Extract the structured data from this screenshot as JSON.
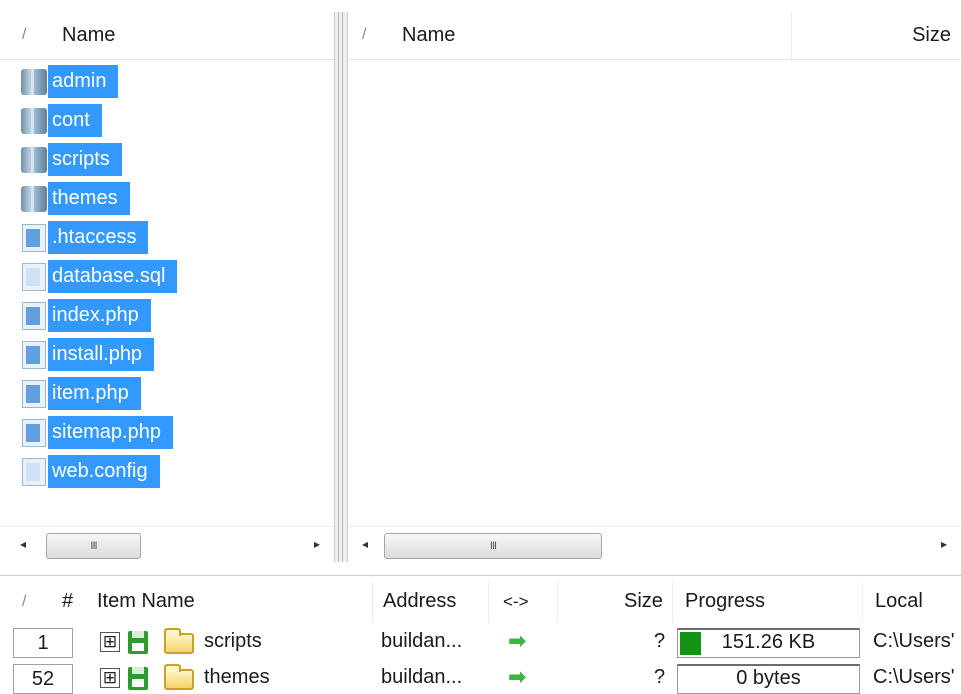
{
  "left_pane": {
    "sort_glyph": "/",
    "header_name": "Name",
    "scroll_thumb_grip": "III",
    "scroll_left": "◂",
    "scroll_right": "▸",
    "files": [
      {
        "name": "admin",
        "icon": "folder-icon"
      },
      {
        "name": "cont",
        "icon": "folder-icon"
      },
      {
        "name": "scripts",
        "icon": "folder-icon"
      },
      {
        "name": "themes",
        "icon": "folder-icon"
      },
      {
        "name": ".htaccess",
        "icon": "file-icon"
      },
      {
        "name": "database.sql",
        "icon": "file-icon"
      },
      {
        "name": "index.php",
        "icon": "file-icon"
      },
      {
        "name": "install.php",
        "icon": "file-icon"
      },
      {
        "name": "item.php",
        "icon": "file-icon"
      },
      {
        "name": "sitemap.php",
        "icon": "file-icon"
      },
      {
        "name": "web.config",
        "icon": "file-icon"
      }
    ]
  },
  "right_pane": {
    "sort_glyph": "/",
    "header_name": "Name",
    "header_size": "Size",
    "scroll_thumb_grip": "III",
    "scroll_left": "◂",
    "scroll_right": "▸"
  },
  "queue": {
    "headers": {
      "sort": "/",
      "num": "#",
      "item_name": "Item Name",
      "address": "Address",
      "direction": "<->",
      "size": "Size",
      "progress": "Progress",
      "local": "Local"
    },
    "rows": [
      {
        "num": "1",
        "expand": "⊞",
        "name": "scripts",
        "address": "buildan...",
        "direction": "➡",
        "size": "?",
        "progress_fraction": 0.12,
        "progress_text": "151.26 KB",
        "local": "C:\\Users'"
      },
      {
        "num": "52",
        "expand": "⊞",
        "name": "themes",
        "address": "buildan...",
        "direction": "➡",
        "size": "?",
        "progress_fraction": 0,
        "progress_text": "0 bytes",
        "local": "C:\\Users'"
      }
    ]
  },
  "colors": {
    "selection": "#3399ff",
    "progress": "#149414",
    "arrow": "#3fb53f"
  }
}
